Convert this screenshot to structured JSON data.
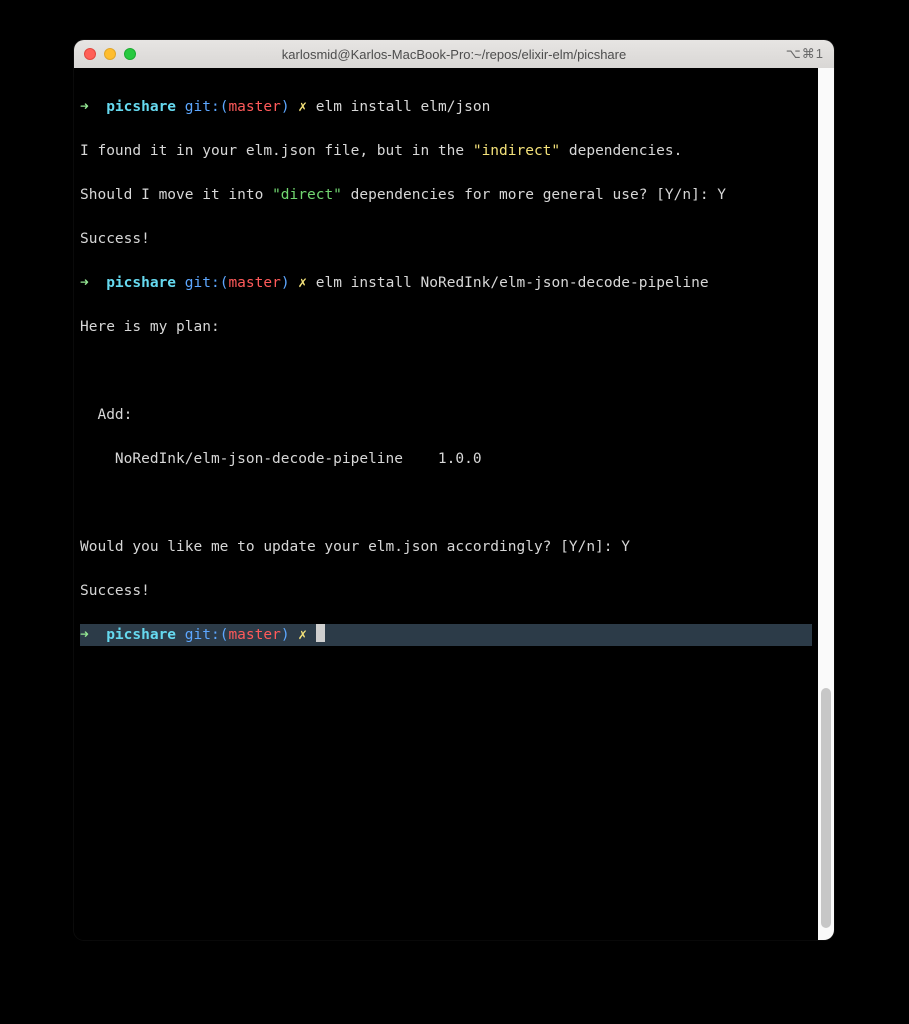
{
  "window": {
    "title": "karlosmid@Karlos-MacBook-Pro:~/repos/elixir-elm/picshare",
    "shortcut": "⌥⌘1"
  },
  "prompt": {
    "arrow": "➜",
    "dir": "picshare",
    "git_label": "git:(",
    "branch": "master",
    "git_close": ")",
    "dirty": "✗"
  },
  "cmd1": "elm install elm/json",
  "out1_a_pre": "I found it in your elm.json file, but in the ",
  "out1_a_q": "\"indirect\"",
  "out1_a_post": " dependencies.",
  "out1_b_pre": "Should I move it into ",
  "out1_b_q": "\"direct\"",
  "out1_b_post": " dependencies for more general use? [Y/n]: Y",
  "out1_c": "Success!",
  "cmd2": "elm install NoRedInk/elm-json-decode-pipeline",
  "out2_a": "Here is my plan:",
  "out2_b": "  Add:",
  "out2_c": "    NoRedInk/elm-json-decode-pipeline    1.0.0",
  "out2_d": "Would you like me to update your elm.json accordingly? [Y/n]: Y",
  "out2_e": "Success!"
}
